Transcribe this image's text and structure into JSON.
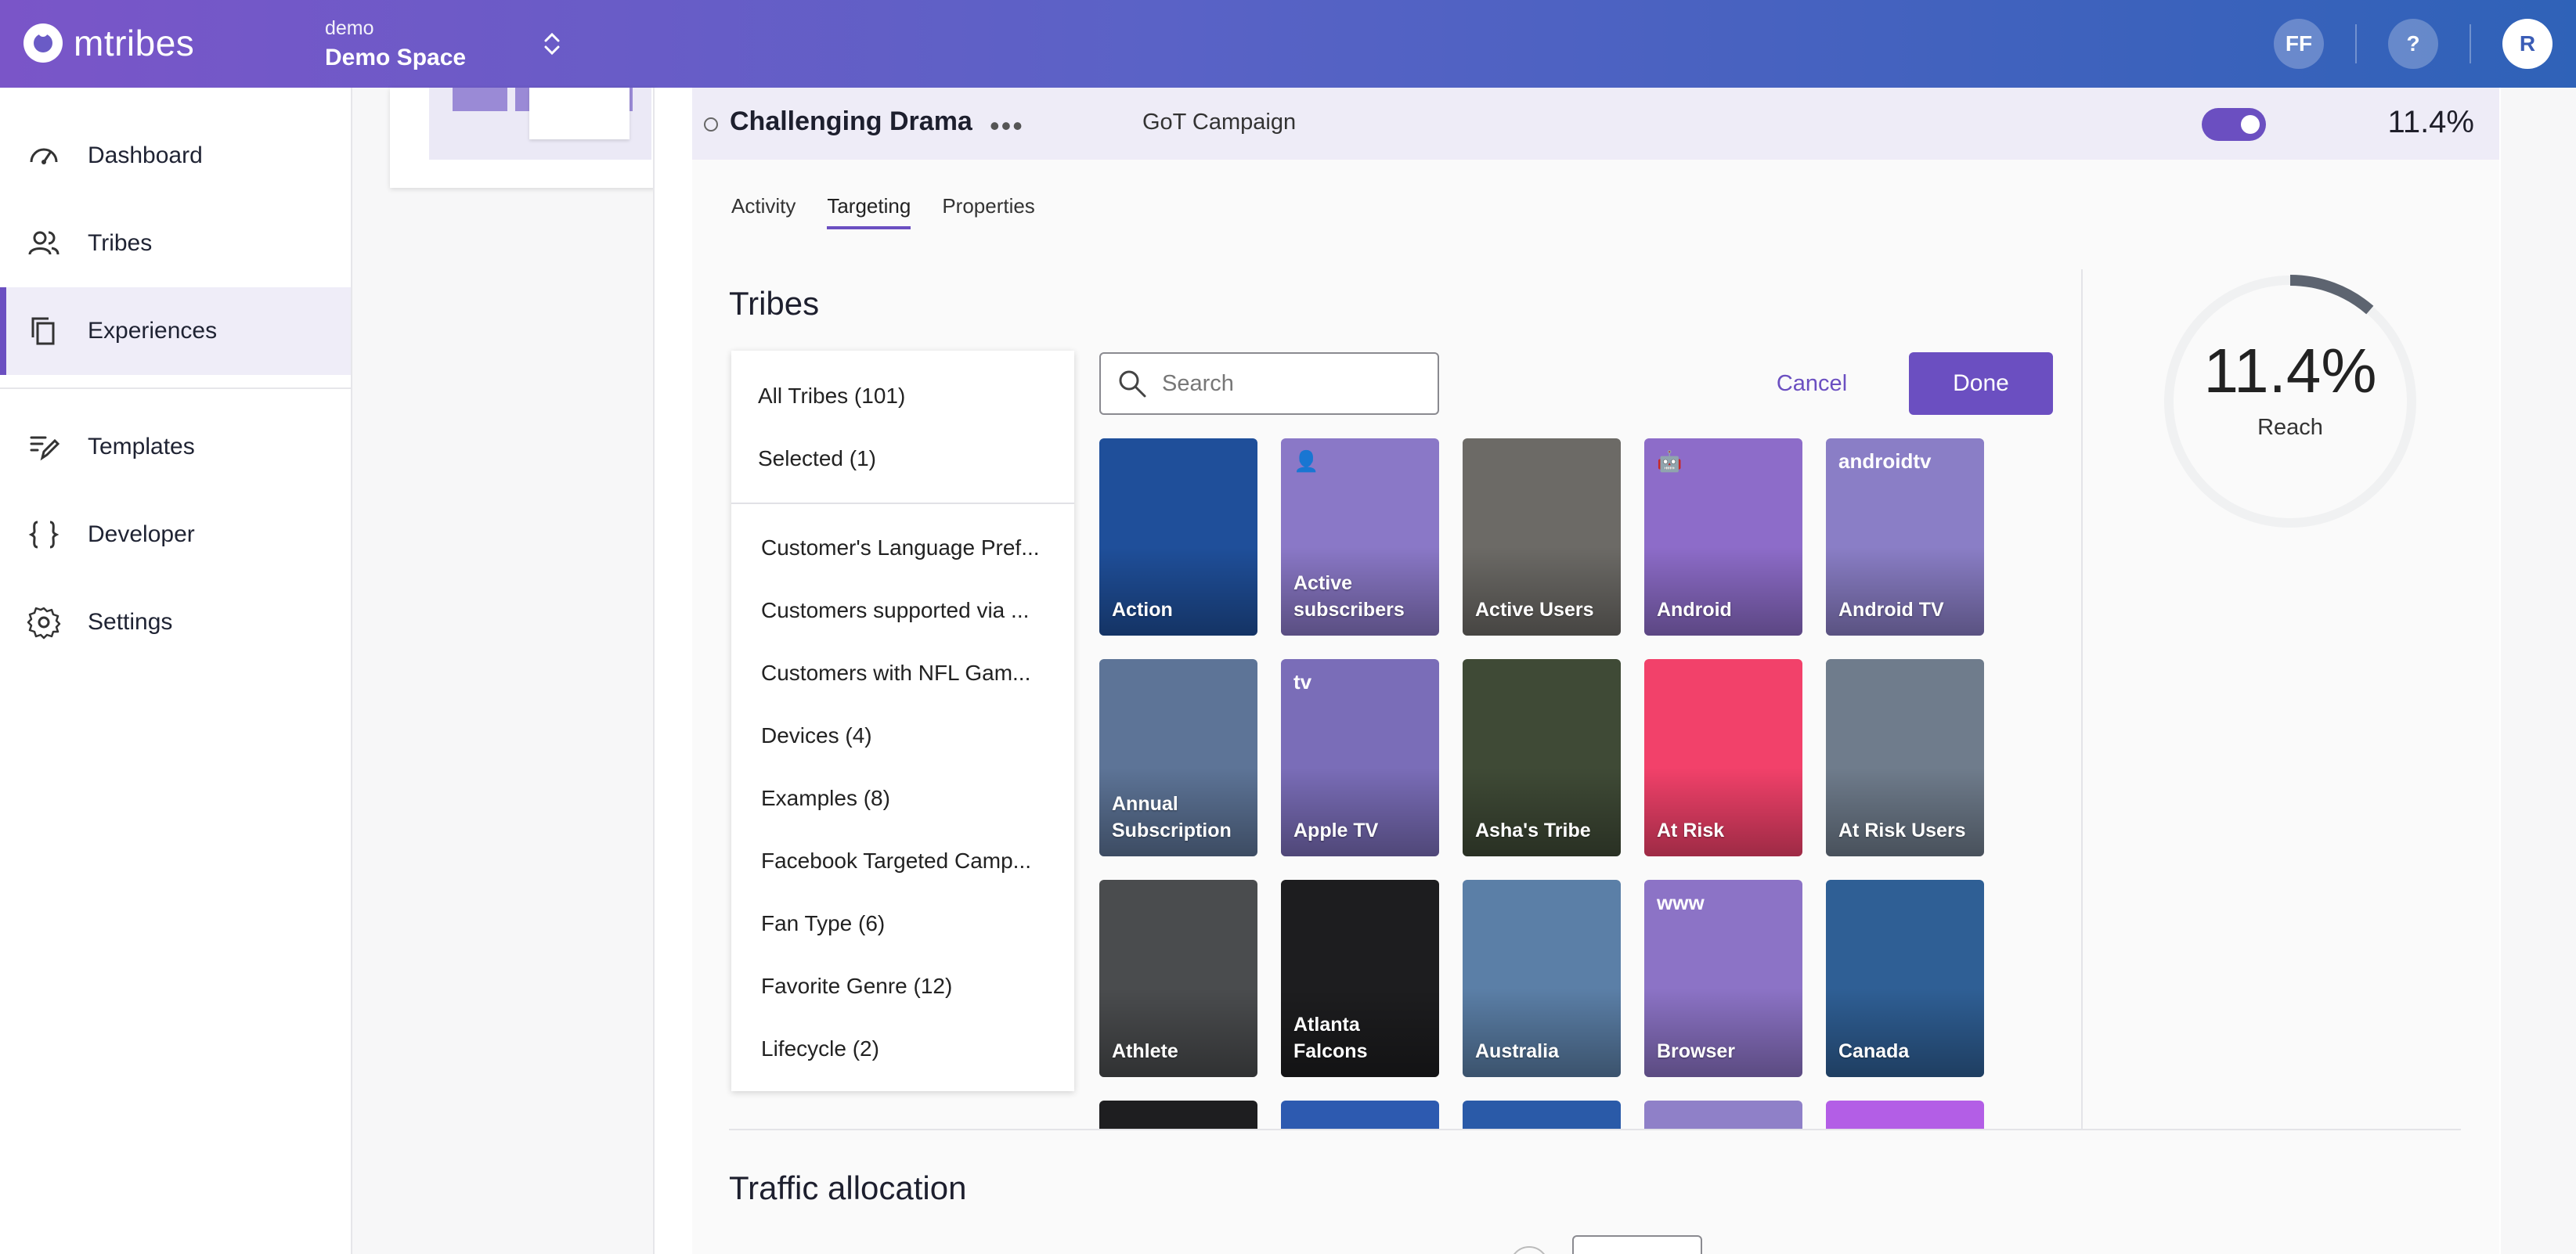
{
  "app": {
    "name": "mtribes"
  },
  "space": {
    "org": "demo",
    "name": "Demo Space"
  },
  "header": {
    "avatar_ff": "FF",
    "help": "?",
    "user": "R"
  },
  "sidebar": {
    "items": [
      {
        "label": "Dashboard",
        "icon": "dashboard-icon"
      },
      {
        "label": "Tribes",
        "icon": "users-icon"
      },
      {
        "label": "Experiences",
        "icon": "copy-icon",
        "active": true
      },
      {
        "label": "Templates",
        "icon": "edit-icon"
      },
      {
        "label": "Developer",
        "icon": "braces-icon"
      },
      {
        "label": "Settings",
        "icon": "gear-icon"
      }
    ]
  },
  "experience": {
    "name": "Challenging Drama",
    "more": "•••",
    "campaign": "GoT Campaign",
    "enabled": true,
    "reach": "11.4%"
  },
  "tabs": [
    {
      "label": "Activity"
    },
    {
      "label": "Targeting",
      "active": true
    },
    {
      "label": "Properties"
    }
  ],
  "tribes_section": {
    "title": "Tribes",
    "filters": [
      "All Tribes (101)",
      "Selected (1)",
      "Customer's Language Pref...",
      "Customers supported via ...",
      "Customers with NFL Gam...",
      "Devices (4)",
      "Examples (8)",
      "Facebook Targeted Camp...",
      "Fan Type (6)",
      "Favorite Genre (12)",
      "Lifecycle (2)"
    ],
    "search_placeholder": "Search",
    "cancel_label": "Cancel",
    "done_label": "Done",
    "tiles": [
      {
        "label": "Action",
        "color": "#1f4f9a"
      },
      {
        "label": "Active subscribers",
        "color": "#8a78c7",
        "icon": "👤"
      },
      {
        "label": "Active Users",
        "color": "#6c6a66"
      },
      {
        "label": "Android",
        "color": "#8d6cc9",
        "icon": "🤖"
      },
      {
        "label": "Android TV",
        "color": "#8a7ec6",
        "icon": "androidtv"
      },
      {
        "label": "Annual Subscription",
        "color": "#5d7497"
      },
      {
        "label": "Apple TV",
        "color": "#7a6db8",
        "icon": "tv"
      },
      {
        "label": "Asha's Tribe",
        "color": "#3f4a36"
      },
      {
        "label": "At Risk",
        "color": "#f2416a"
      },
      {
        "label": "At Risk Users",
        "color": "#6f7c8c"
      },
      {
        "label": "Athlete",
        "color": "#4a4c4e"
      },
      {
        "label": "Atlanta Falcons",
        "color": "#1d1d1f"
      },
      {
        "label": "Australia",
        "color": "#5b7fa7"
      },
      {
        "label": "Browser",
        "color": "#8c73c6",
        "icon": "www"
      },
      {
        "label": "Canada",
        "color": "#2f5f95"
      },
      {
        "label": "",
        "color": "#1e1e20"
      },
      {
        "label": "",
        "color": "#2d5ab0"
      },
      {
        "label": "",
        "color": "#2a5aa8"
      },
      {
        "label": "",
        "color": "#8f80c8"
      },
      {
        "label": "",
        "color": "#b35ee6"
      }
    ]
  },
  "reach": {
    "value": "11.4%",
    "label": "Reach",
    "fraction": 0.114,
    "color": "#5d6470"
  },
  "traffic": {
    "title": "Traffic allocation"
  }
}
